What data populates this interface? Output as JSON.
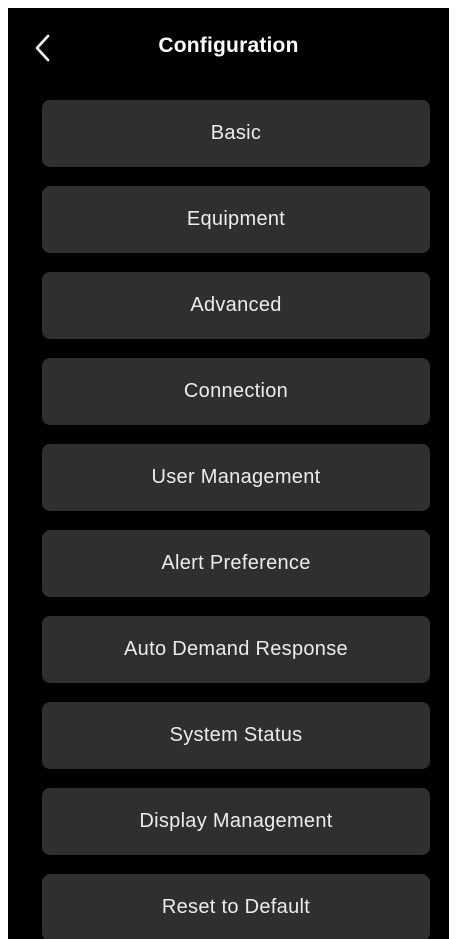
{
  "header": {
    "title": "Configuration",
    "back_icon": "chevron-left-icon"
  },
  "colors": {
    "background": "#000000",
    "button": "#2f2f2f",
    "text": "#ffffff"
  },
  "menu": {
    "items": [
      {
        "label": "Basic"
      },
      {
        "label": "Equipment"
      },
      {
        "label": "Advanced"
      },
      {
        "label": "Connection"
      },
      {
        "label": "User Management"
      },
      {
        "label": "Alert Preference"
      },
      {
        "label": "Auto Demand Response"
      },
      {
        "label": "System Status"
      },
      {
        "label": "Display Management"
      },
      {
        "label": "Reset to Default"
      }
    ]
  }
}
